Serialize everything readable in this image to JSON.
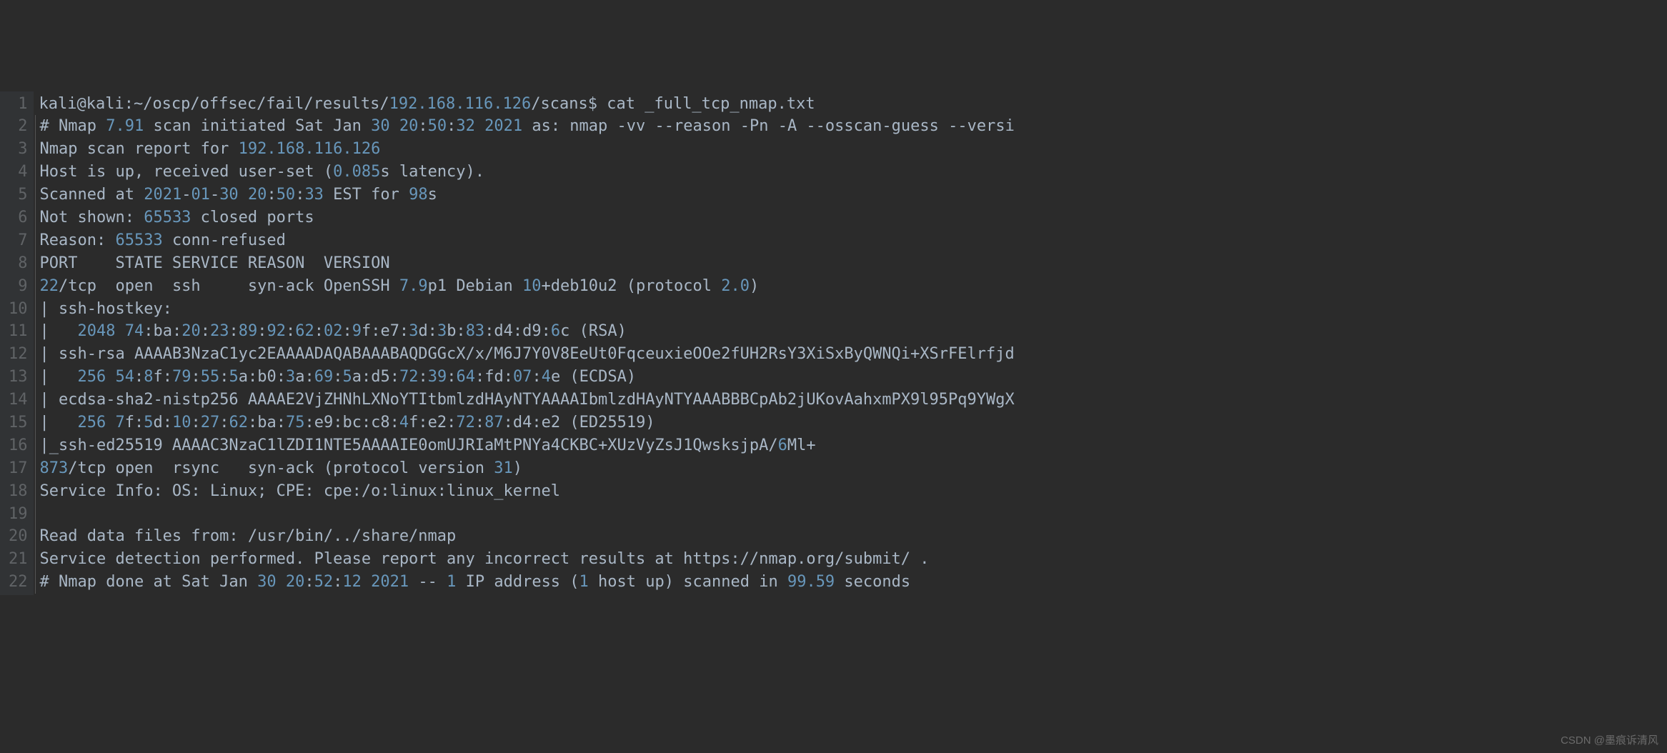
{
  "watermark": "CSDN @墨痕诉清风",
  "gutter": [
    "1",
    "2",
    "3",
    "4",
    "5",
    "6",
    "7",
    "8",
    "9",
    "10",
    "11",
    "12",
    "13",
    "14",
    "15",
    "16",
    "17",
    "18",
    "19",
    "20",
    "21",
    "22"
  ],
  "lines": [
    [
      {
        "c": "t",
        "v": "kali@kali:~/oscp/offsec/fail/results/"
      },
      {
        "c": "n",
        "v": "192.168.116.126"
      },
      {
        "c": "t",
        "v": "/scans$ cat _full_tcp_nmap.txt"
      }
    ],
    [
      {
        "c": "t",
        "v": "# Nmap "
      },
      {
        "c": "n",
        "v": "7.91"
      },
      {
        "c": "t",
        "v": " scan initiated Sat Jan "
      },
      {
        "c": "n",
        "v": "30"
      },
      {
        "c": "t",
        "v": " "
      },
      {
        "c": "n",
        "v": "20"
      },
      {
        "c": "t",
        "v": ":"
      },
      {
        "c": "n",
        "v": "50"
      },
      {
        "c": "t",
        "v": ":"
      },
      {
        "c": "n",
        "v": "32"
      },
      {
        "c": "t",
        "v": " "
      },
      {
        "c": "n",
        "v": "2021"
      },
      {
        "c": "t",
        "v": " as: nmap -vv --reason -Pn -A --osscan-guess --versi"
      }
    ],
    [
      {
        "c": "t",
        "v": "Nmap scan report for "
      },
      {
        "c": "n",
        "v": "192.168.116.126"
      }
    ],
    [
      {
        "c": "t",
        "v": "Host is up, received user-set ("
      },
      {
        "c": "n",
        "v": "0.085"
      },
      {
        "c": "t",
        "v": "s latency)."
      }
    ],
    [
      {
        "c": "t",
        "v": "Scanned at "
      },
      {
        "c": "n",
        "v": "2021"
      },
      {
        "c": "t",
        "v": "-"
      },
      {
        "c": "n",
        "v": "01"
      },
      {
        "c": "t",
        "v": "-"
      },
      {
        "c": "n",
        "v": "30"
      },
      {
        "c": "t",
        "v": " "
      },
      {
        "c": "n",
        "v": "20"
      },
      {
        "c": "t",
        "v": ":"
      },
      {
        "c": "n",
        "v": "50"
      },
      {
        "c": "t",
        "v": ":"
      },
      {
        "c": "n",
        "v": "33"
      },
      {
        "c": "t",
        "v": " EST for "
      },
      {
        "c": "n",
        "v": "98"
      },
      {
        "c": "t",
        "v": "s"
      }
    ],
    [
      {
        "c": "t",
        "v": "Not shown: "
      },
      {
        "c": "n",
        "v": "65533"
      },
      {
        "c": "t",
        "v": " closed ports"
      }
    ],
    [
      {
        "c": "t",
        "v": "Reason: "
      },
      {
        "c": "n",
        "v": "65533"
      },
      {
        "c": "t",
        "v": " conn-refused"
      }
    ],
    [
      {
        "c": "t",
        "v": "PORT    STATE SERVICE REASON  VERSION"
      }
    ],
    [
      {
        "c": "n",
        "v": "22"
      },
      {
        "c": "t",
        "v": "/tcp  open  ssh     syn-ack OpenSSH "
      },
      {
        "c": "n",
        "v": "7.9"
      },
      {
        "c": "t",
        "v": "p1 Debian "
      },
      {
        "c": "n",
        "v": "10"
      },
      {
        "c": "t",
        "v": "+deb10u2 (protocol "
      },
      {
        "c": "n",
        "v": "2.0"
      },
      {
        "c": "t",
        "v": ")"
      }
    ],
    [
      {
        "c": "t",
        "v": "| ssh-hostkey: "
      }
    ],
    [
      {
        "c": "t",
        "v": "|   "
      },
      {
        "c": "n",
        "v": "2048"
      },
      {
        "c": "t",
        "v": " "
      },
      {
        "c": "n",
        "v": "74"
      },
      {
        "c": "t",
        "v": ":ba:"
      },
      {
        "c": "n",
        "v": "20"
      },
      {
        "c": "t",
        "v": ":"
      },
      {
        "c": "n",
        "v": "23"
      },
      {
        "c": "t",
        "v": ":"
      },
      {
        "c": "n",
        "v": "89"
      },
      {
        "c": "t",
        "v": ":"
      },
      {
        "c": "n",
        "v": "92"
      },
      {
        "c": "t",
        "v": ":"
      },
      {
        "c": "n",
        "v": "62"
      },
      {
        "c": "t",
        "v": ":"
      },
      {
        "c": "n",
        "v": "02"
      },
      {
        "c": "t",
        "v": ":"
      },
      {
        "c": "n",
        "v": "9"
      },
      {
        "c": "t",
        "v": "f:e7:"
      },
      {
        "c": "n",
        "v": "3"
      },
      {
        "c": "t",
        "v": "d:"
      },
      {
        "c": "n",
        "v": "3"
      },
      {
        "c": "t",
        "v": "b:"
      },
      {
        "c": "n",
        "v": "83"
      },
      {
        "c": "t",
        "v": ":d4:d9:"
      },
      {
        "c": "n",
        "v": "6"
      },
      {
        "c": "t",
        "v": "c (RSA)"
      }
    ],
    [
      {
        "c": "t",
        "v": "| ssh-rsa AAAAB3NzaC1yc2EAAAADAQABAAABAQDGGcX/x/M6J7Y0V8EeUt0FqceuxieOOe2fUH2RsY3XiSxByQWNQi+XSrFElrfjd"
      }
    ],
    [
      {
        "c": "t",
        "v": "|   "
      },
      {
        "c": "n",
        "v": "256"
      },
      {
        "c": "t",
        "v": " "
      },
      {
        "c": "n",
        "v": "54"
      },
      {
        "c": "t",
        "v": ":"
      },
      {
        "c": "n",
        "v": "8"
      },
      {
        "c": "t",
        "v": "f:"
      },
      {
        "c": "n",
        "v": "79"
      },
      {
        "c": "t",
        "v": ":"
      },
      {
        "c": "n",
        "v": "55"
      },
      {
        "c": "t",
        "v": ":"
      },
      {
        "c": "n",
        "v": "5"
      },
      {
        "c": "t",
        "v": "a:b0:"
      },
      {
        "c": "n",
        "v": "3"
      },
      {
        "c": "t",
        "v": "a:"
      },
      {
        "c": "n",
        "v": "69"
      },
      {
        "c": "t",
        "v": ":"
      },
      {
        "c": "n",
        "v": "5"
      },
      {
        "c": "t",
        "v": "a:d5:"
      },
      {
        "c": "n",
        "v": "72"
      },
      {
        "c": "t",
        "v": ":"
      },
      {
        "c": "n",
        "v": "39"
      },
      {
        "c": "t",
        "v": ":"
      },
      {
        "c": "n",
        "v": "64"
      },
      {
        "c": "t",
        "v": ":fd:"
      },
      {
        "c": "n",
        "v": "07"
      },
      {
        "c": "t",
        "v": ":"
      },
      {
        "c": "n",
        "v": "4"
      },
      {
        "c": "t",
        "v": "e (ECDSA)"
      }
    ],
    [
      {
        "c": "t",
        "v": "| ecdsa-sha2-nistp256 AAAAE2VjZHNhLXNoYTItbmlzdHAyNTYAAAAIbmlzdHAyNTYAAABBBCpAb2jUKovAahxmPX9l95Pq9YWgX"
      }
    ],
    [
      {
        "c": "t",
        "v": "|   "
      },
      {
        "c": "n",
        "v": "256"
      },
      {
        "c": "t",
        "v": " "
      },
      {
        "c": "n",
        "v": "7"
      },
      {
        "c": "t",
        "v": "f:"
      },
      {
        "c": "n",
        "v": "5"
      },
      {
        "c": "t",
        "v": "d:"
      },
      {
        "c": "n",
        "v": "10"
      },
      {
        "c": "t",
        "v": ":"
      },
      {
        "c": "n",
        "v": "27"
      },
      {
        "c": "t",
        "v": ":"
      },
      {
        "c": "n",
        "v": "62"
      },
      {
        "c": "t",
        "v": ":ba:"
      },
      {
        "c": "n",
        "v": "75"
      },
      {
        "c": "t",
        "v": ":e9:bc:c8:"
      },
      {
        "c": "n",
        "v": "4"
      },
      {
        "c": "t",
        "v": "f:e2:"
      },
      {
        "c": "n",
        "v": "72"
      },
      {
        "c": "t",
        "v": ":"
      },
      {
        "c": "n",
        "v": "87"
      },
      {
        "c": "t",
        "v": ":d4:e2 (ED25519)"
      }
    ],
    [
      {
        "c": "t",
        "v": "|_ssh-ed25519 AAAAC3NzaC1lZDI1NTE5AAAAIE0omUJRIaMtPNYa4CKBC+XUzVyZsJ1QwsksjpA/"
      },
      {
        "c": "n",
        "v": "6"
      },
      {
        "c": "t",
        "v": "Ml+"
      }
    ],
    [
      {
        "c": "n",
        "v": "873"
      },
      {
        "c": "t",
        "v": "/tcp open  rsync   syn-ack (protocol version "
      },
      {
        "c": "n",
        "v": "31"
      },
      {
        "c": "t",
        "v": ")"
      }
    ],
    [
      {
        "c": "t",
        "v": "Service Info: OS: Linux; CPE: cpe:/o:linux:linux_kernel"
      }
    ],
    [
      {
        "c": "t",
        "v": ""
      }
    ],
    [
      {
        "c": "t",
        "v": "Read data files from: /usr/bin/../share/nmap"
      }
    ],
    [
      {
        "c": "t",
        "v": "Service detection performed. Please report any incorrect results at https://nmap.org/submit/ ."
      }
    ],
    [
      {
        "c": "t",
        "v": "# Nmap done at Sat Jan "
      },
      {
        "c": "n",
        "v": "30"
      },
      {
        "c": "t",
        "v": " "
      },
      {
        "c": "n",
        "v": "20"
      },
      {
        "c": "t",
        "v": ":"
      },
      {
        "c": "n",
        "v": "52"
      },
      {
        "c": "t",
        "v": ":"
      },
      {
        "c": "n",
        "v": "12"
      },
      {
        "c": "t",
        "v": " "
      },
      {
        "c": "n",
        "v": "2021"
      },
      {
        "c": "t",
        "v": " -- "
      },
      {
        "c": "n",
        "v": "1"
      },
      {
        "c": "t",
        "v": " IP address ("
      },
      {
        "c": "n",
        "v": "1"
      },
      {
        "c": "t",
        "v": " host up) scanned in "
      },
      {
        "c": "n",
        "v": "99.59"
      },
      {
        "c": "t",
        "v": " seconds"
      }
    ]
  ]
}
